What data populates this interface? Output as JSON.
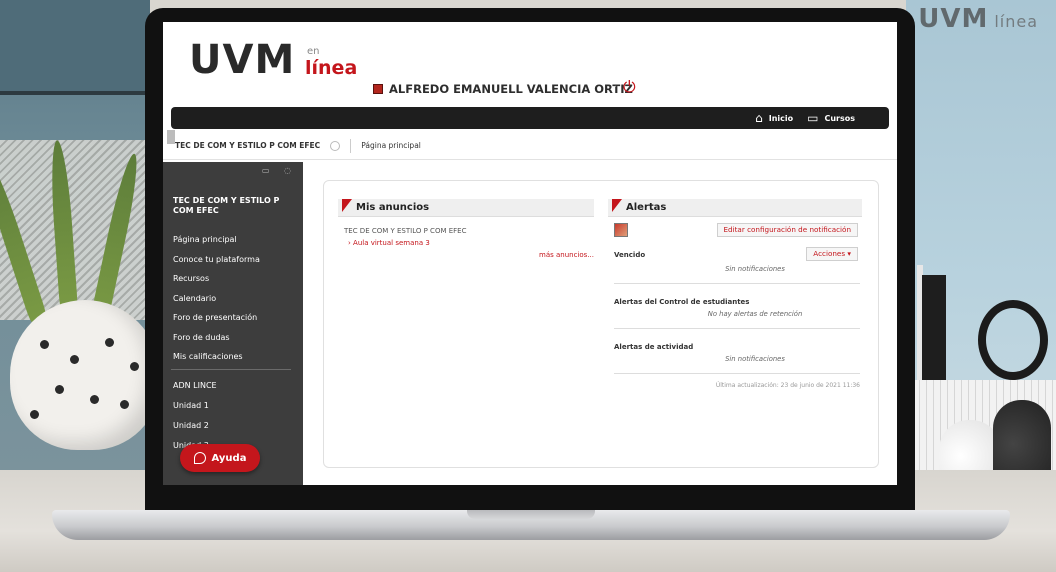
{
  "background": {
    "wall_logo_main": "UVM",
    "wall_logo_sub": "línea"
  },
  "header": {
    "logo_main": "UVM",
    "logo_en": "en",
    "logo_linea": "línea",
    "user_name": "ALFREDO EMANUELL VALENCIA ORTIZ"
  },
  "topnav": {
    "items": [
      {
        "label": "Inicio",
        "icon": "home-icon"
      },
      {
        "label": "Cursos",
        "icon": "courses-icon"
      }
    ]
  },
  "breadcrumb": {
    "course": "TEC DE COM Y ESTILO P COM EFEC",
    "page": "Página principal"
  },
  "sidebar": {
    "course_title": "TEC DE COM Y ESTILO P COM EFEC",
    "items": [
      "Página principal",
      "Conoce tu plataforma",
      "Recursos",
      "Calendario",
      "Foro de presentación",
      "Foro de dudas",
      "Mis calificaciones"
    ],
    "items2": [
      "ADN LINCE",
      "Unidad 1",
      "Unidad 2",
      "Unidad 3"
    ],
    "help_label": "Ayuda"
  },
  "anuncios": {
    "title": "Mis anuncios",
    "course": "TEC DE COM Y ESTILO P COM EFEC",
    "item": "Aula virtual semana 3",
    "more": "más anuncios..."
  },
  "alertas": {
    "title": "Alertas",
    "edit_button": "Editar configuración de notificación",
    "actions_button": "Acciones",
    "sections": [
      {
        "label": "Vencido",
        "empty": "Sin notificaciones"
      },
      {
        "label": "Alertas del Control de estudiantes",
        "empty": "No hay alertas de retención"
      },
      {
        "label": "Alertas de actividad",
        "empty": "Sin notificaciones"
      }
    ],
    "updated": "Última actualización: 23 de junio de 2021 11:36"
  },
  "colors": {
    "accent": "#c4161c",
    "nav_bar": "#1e1e1e",
    "sidebar": "#3d3d3d"
  }
}
